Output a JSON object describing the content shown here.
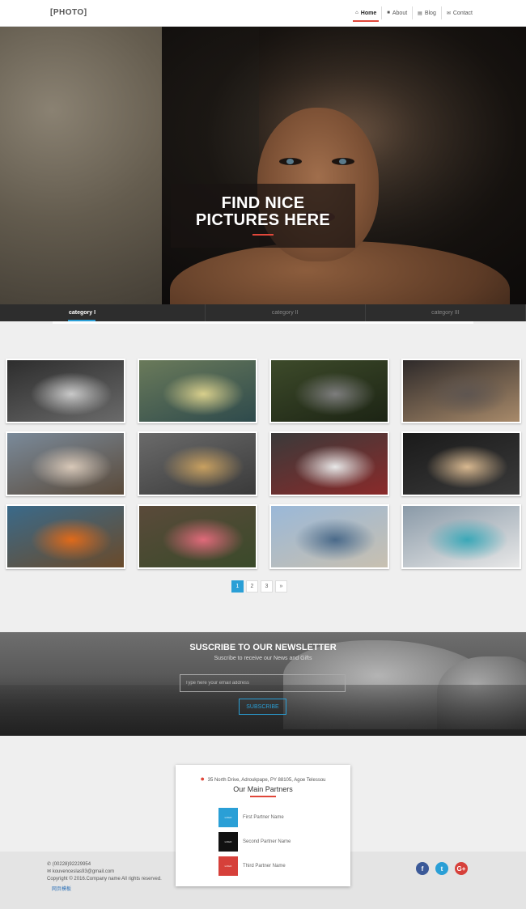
{
  "header": {
    "brand": "[PHOTO]",
    "nav": [
      {
        "icon": "⌂",
        "label": "Home",
        "active": true
      },
      {
        "icon": "■",
        "label": "About"
      },
      {
        "icon": "▤",
        "label": "Blog"
      },
      {
        "icon": "✉",
        "label": "Contact"
      }
    ]
  },
  "hero": {
    "title_line1": "FIND NICE",
    "title_line2": "PICTURES HERE"
  },
  "tabs": [
    "category I",
    "category II",
    "category III"
  ],
  "gallery": {
    "thumbs": [
      {
        "colors": [
          "#2d2d2d",
          "#c9c9c9",
          "#6a6a6a"
        ]
      },
      {
        "colors": [
          "#6a7a5a",
          "#d8cf8c",
          "#2e4a4c"
        ]
      },
      {
        "colors": [
          "#3d4a2a",
          "#7d7d7d",
          "#1c2414"
        ]
      },
      {
        "colors": [
          "#2e2a2a",
          "#5e5550",
          "#a88a6a"
        ]
      },
      {
        "colors": [
          "#7a8a9a",
          "#d8c8b8",
          "#5a4a3a"
        ]
      },
      {
        "colors": [
          "#6a6a6a",
          "#c8a060",
          "#3a3a3a"
        ]
      },
      {
        "colors": [
          "#3a3a3a",
          "#e8e8e8",
          "#8a2a2a"
        ]
      },
      {
        "colors": [
          "#1a1a1a",
          "#d8b890",
          "#3a3a3a"
        ]
      },
      {
        "colors": [
          "#3a6a8a",
          "#e06a1a",
          "#6a4a2a"
        ]
      },
      {
        "colors": [
          "#5a4a3a",
          "#e06a7a",
          "#3a4a2a"
        ]
      },
      {
        "colors": [
          "#9ab8d8",
          "#4a6a8a",
          "#c8c0b0"
        ]
      },
      {
        "colors": [
          "#8a9aa8",
          "#3aa8b8",
          "#e8e8e8"
        ]
      }
    ]
  },
  "pagination": {
    "pages": [
      "1",
      "2",
      "3",
      "»"
    ],
    "active": "1"
  },
  "newsletter": {
    "title": "SUSCRIBE TO OUR NEWSLETTER",
    "subtitle": "Suscribe to receive our News and Gifts",
    "placeholder": "Type here your email address",
    "button": "SUBSCRIBE"
  },
  "partners": {
    "address": "35 North Drive, Adroukpape, PY 88105, Agoe Telessou",
    "title": "Our Main Partners",
    "items": [
      {
        "logo": "LOGO",
        "name": "First Partner Name",
        "color": "#2a9fd6"
      },
      {
        "logo": "LOGO",
        "name": "Second Partner Name",
        "color": "#111111"
      },
      {
        "logo": "LOGO",
        "name": "Third Partner Name",
        "color": "#d6403a"
      }
    ]
  },
  "footer": {
    "phone": "(00228)92229954",
    "email": "kouvenceslas93@gmail.com",
    "copyright": "Copyright © 2016.Company name All rights reserved.",
    "link": "网页模板"
  },
  "social": [
    {
      "icon": "facebook-icon",
      "glyph": "f",
      "color": "#3b5998"
    },
    {
      "icon": "twitter-icon",
      "glyph": "t",
      "color": "#2a9fd6"
    },
    {
      "icon": "google-plus-icon",
      "glyph": "G+",
      "color": "#d6403a"
    }
  ]
}
